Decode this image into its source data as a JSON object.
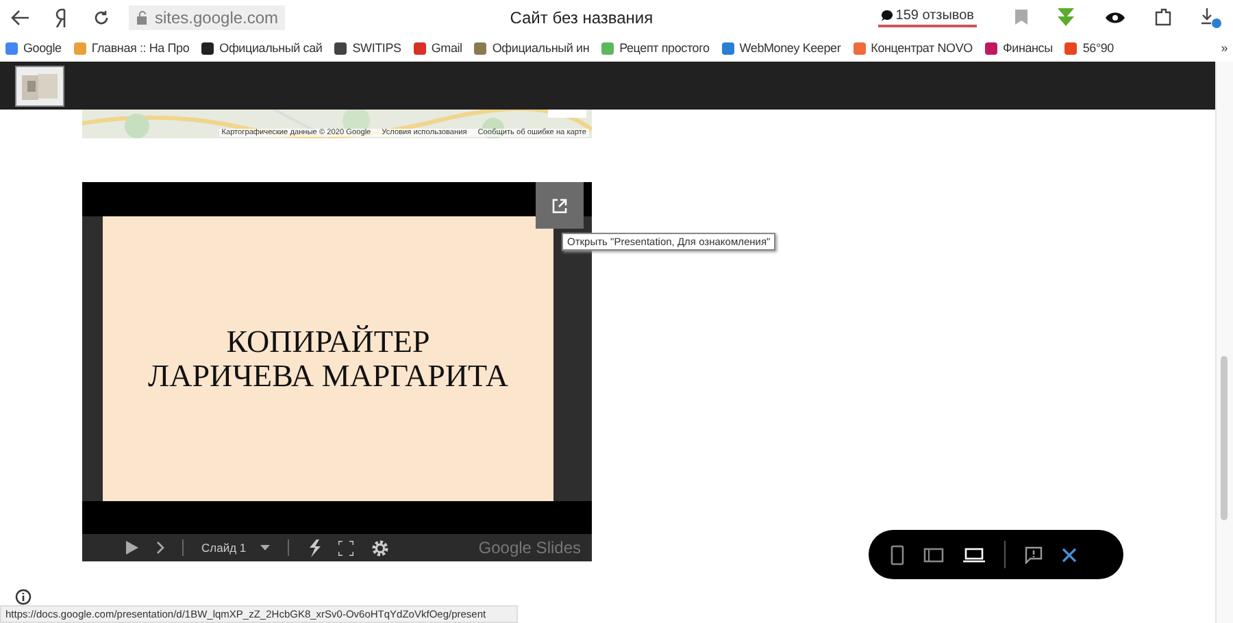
{
  "browser": {
    "address": "sites.google.com",
    "title": "Сайт без названия",
    "reviews": "159 отзывов",
    "bookmarks": [
      {
        "label": "Google",
        "color": "#4285f4"
      },
      {
        "label": "Главная :: На Про",
        "color": "#e8a23a"
      },
      {
        "label": "Официальный сай",
        "color": "#222222"
      },
      {
        "label": "SWITIPS",
        "color": "#444444"
      },
      {
        "label": "Gmail",
        "color": "#d93025"
      },
      {
        "label": "Официальный ин",
        "color": "#8a7a50"
      },
      {
        "label": "Рецепт простого",
        "color": "#5cb85c"
      },
      {
        "label": "WebMoney Keeper",
        "color": "#2a7fd4"
      },
      {
        "label": "Концентрат NOVO",
        "color": "#f06a3a"
      },
      {
        "label": "Финансы",
        "color": "#c2185b"
      },
      {
        "label": "56°90",
        "color": "#e8461e"
      }
    ],
    "more": "»"
  },
  "map": {
    "attribution": [
      "Картографические данные © 2020 Google",
      "Условия использования",
      "Сообщить об ошибке на карте"
    ]
  },
  "embed": {
    "slide_lines": [
      "КОПИРАЙТЕР",
      "ЛАРИЧЕВА МАРГАРИТА"
    ],
    "slide_label": "Слайд 1",
    "brand": "Google Slides",
    "tooltip": "Открыть \"Presentation, Для ознакомления\""
  },
  "device_toolbar": {
    "devices": [
      {
        "kind": "phone",
        "selected": false
      },
      {
        "kind": "tablet",
        "selected": false
      },
      {
        "kind": "laptop",
        "selected": true
      }
    ]
  },
  "status_url": "https://docs.google.com/presentation/d/1BW_lqmXP_zZ_2HcbGK8_xrSv0-Ov6oHTqYdZoVkfOeg/present"
}
